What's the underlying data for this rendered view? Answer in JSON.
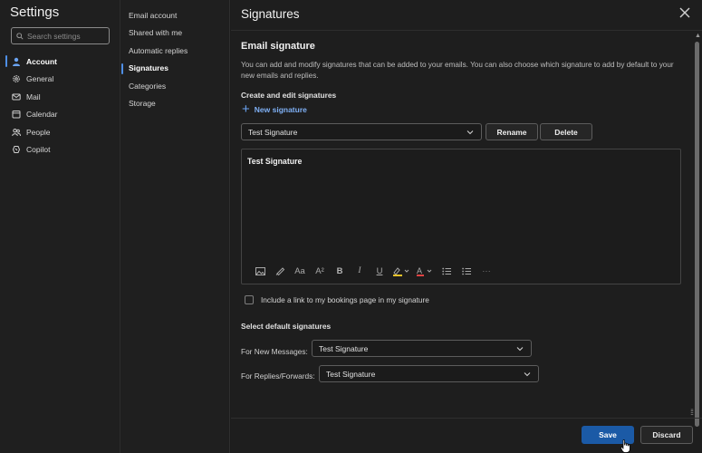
{
  "settings": {
    "title": "Settings",
    "search_placeholder": "Search settings",
    "nav": [
      {
        "label": "Account",
        "icon": "person-icon"
      },
      {
        "label": "General",
        "icon": "gear-icon"
      },
      {
        "label": "Mail",
        "icon": "mail-icon"
      },
      {
        "label": "Calendar",
        "icon": "calendar-icon"
      },
      {
        "label": "People",
        "icon": "people-icon"
      },
      {
        "label": "Copilot",
        "icon": "copilot-icon"
      }
    ],
    "subnav": [
      {
        "label": "Email account"
      },
      {
        "label": "Shared with me"
      },
      {
        "label": "Automatic replies"
      },
      {
        "label": "Signatures"
      },
      {
        "label": "Categories"
      },
      {
        "label": "Storage"
      }
    ]
  },
  "panel": {
    "title": "Signatures",
    "section_title": "Email signature",
    "description": "You can add and modify signatures that can be added to your emails. You can also choose which signature to add by default to your new emails and replies.",
    "create_heading": "Create and edit signatures",
    "new_signature_label": "New signature",
    "selected_signature": "Test Signature",
    "rename_label": "Rename",
    "delete_label": "Delete",
    "editor_content": "Test Signature",
    "bookings_checkbox_label": "Include a link to my bookings page in my signature",
    "defaults_heading": "Select default signatures",
    "new_messages_label": "For New Messages:",
    "new_messages_value": "Test Signature",
    "replies_label": "For Replies/Forwards:",
    "replies_value": "Test Signature",
    "save_label": "Save",
    "discard_label": "Discard"
  },
  "colors": {
    "accent": "#4f8fe6",
    "save_button": "#1b5aa6",
    "background": "#1e1e1e",
    "highlight_marker": "#e6c229",
    "font_color_marker": "#e04343"
  }
}
